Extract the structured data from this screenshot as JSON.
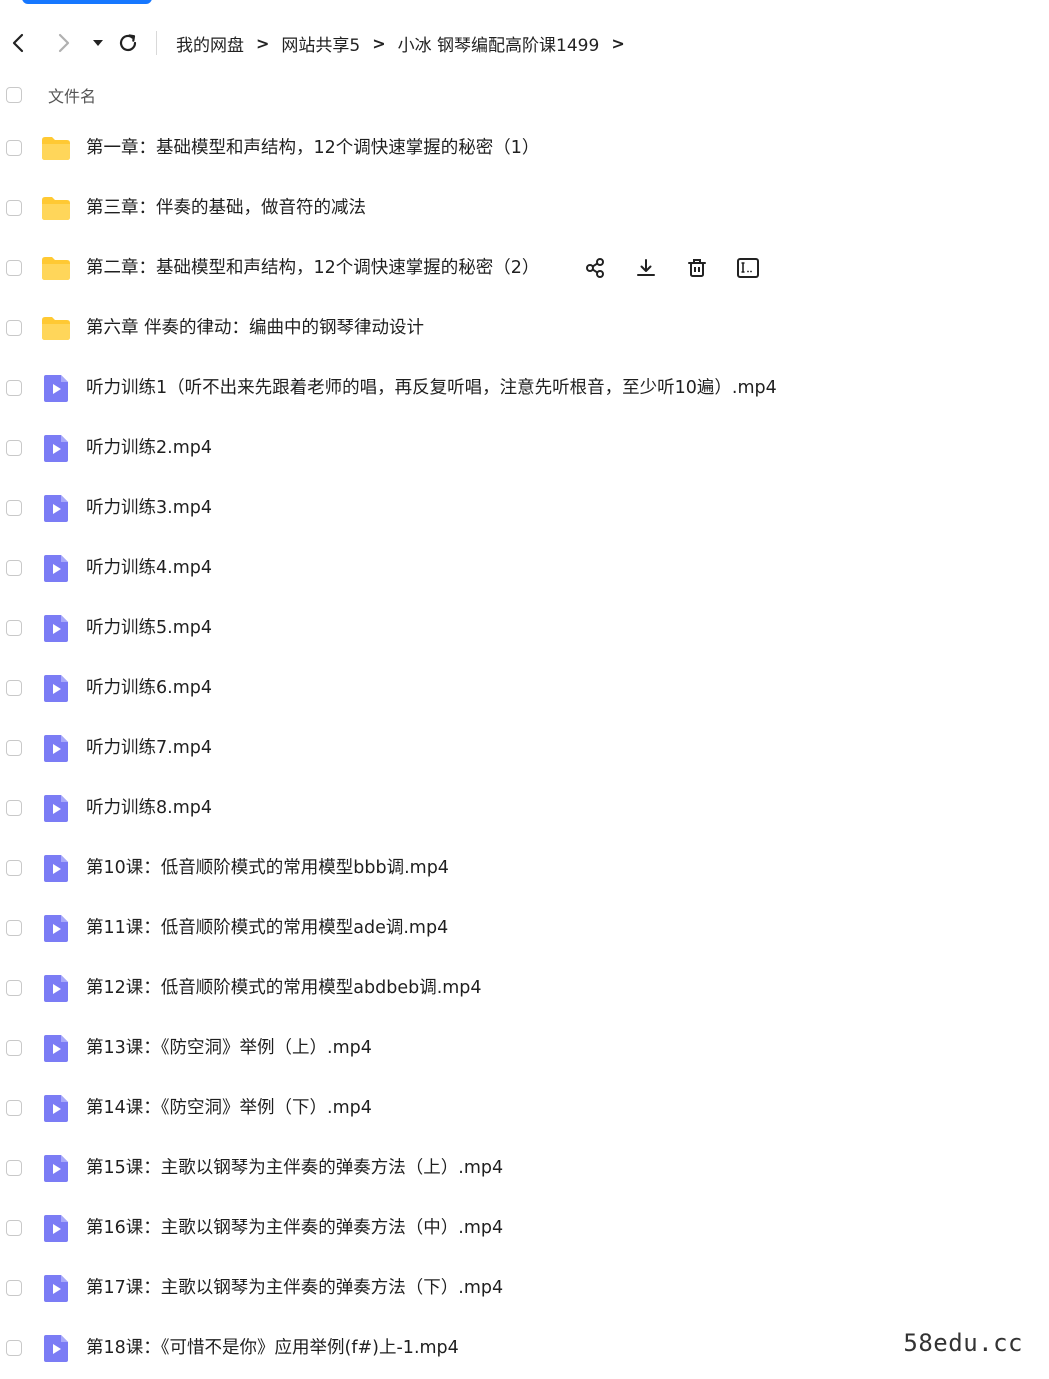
{
  "nav": {
    "back_icon": "chevron-left-icon",
    "forward_icon": "chevron-right-icon",
    "dropdown_icon": "caret-down-icon",
    "refresh_icon": "refresh-icon"
  },
  "breadcrumb": {
    "items": [
      "我的网盘",
      "网站共享5",
      "小冰 钢琴编配高阶课1499"
    ],
    "separator": ">"
  },
  "table": {
    "column_name": "文件名"
  },
  "files": [
    {
      "name": "第一章：基础模型和声结构，12个调快速掌握的秘密（1）",
      "type": "folder"
    },
    {
      "name": "第三章：伴奏的基础，做音符的减法",
      "type": "folder"
    },
    {
      "name": "第二章：基础模型和声结构，12个调快速掌握的秘密（2）",
      "type": "folder"
    },
    {
      "name": "第六章 伴奏的律动：编曲中的钢琴律动设计",
      "type": "folder"
    },
    {
      "name": "听力训练1（听不出来先跟着老师的唱，再反复听唱，注意先听根音，至少听10遍）.mp4",
      "type": "video"
    },
    {
      "name": "听力训练2.mp4",
      "type": "video"
    },
    {
      "name": "听力训练3.mp4",
      "type": "video"
    },
    {
      "name": "听力训练4.mp4",
      "type": "video"
    },
    {
      "name": "听力训练5.mp4",
      "type": "video"
    },
    {
      "name": "听力训练6.mp4",
      "type": "video"
    },
    {
      "name": "听力训练7.mp4",
      "type": "video"
    },
    {
      "name": "听力训练8.mp4",
      "type": "video"
    },
    {
      "name": "第10课：低音顺阶模式的常用模型bbb调.mp4",
      "type": "video"
    },
    {
      "name": "第11课：低音顺阶模式的常用模型ade调.mp4",
      "type": "video"
    },
    {
      "name": "第12课：低音顺阶模式的常用模型abdbeb调.mp4",
      "type": "video"
    },
    {
      "name": "第13课：《防空洞》举例（上）.mp4",
      "type": "video"
    },
    {
      "name": "第14课：《防空洞》举例（下）.mp4",
      "type": "video"
    },
    {
      "name": "第15课：主歌以钢琴为主伴奏的弹奏方法（上）.mp4",
      "type": "video"
    },
    {
      "name": "第16课：主歌以钢琴为主伴奏的弹奏方法（中）.mp4",
      "type": "video"
    },
    {
      "name": "第17课：主歌以钢琴为主伴奏的弹奏方法（下）.mp4",
      "type": "video"
    },
    {
      "name": "第18课：《可惜不是你》应用举例(f#)上-1.mp4",
      "type": "video"
    }
  ],
  "hover_row_index": 2,
  "row_actions": [
    "share-icon",
    "download-icon",
    "delete-icon",
    "rename-icon"
  ],
  "watermark": "58edu.cc",
  "colors": {
    "accent": "#1677ff",
    "folder": "#ffc933",
    "video": "#7b7cf5"
  }
}
